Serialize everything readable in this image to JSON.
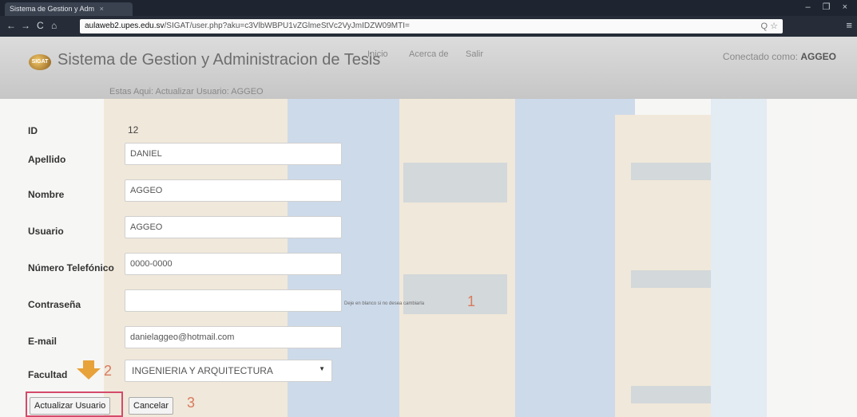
{
  "browser": {
    "tab_title": "Sistema de Gestion y Adm",
    "tab_close": "×",
    "url_host": "aulaweb2.upes.edu.sv",
    "url_path": "/SIGAT/user.php?aku=c3VlbWBPU1vZGlmeStVc2VyJmIDZW09MTI=",
    "back": "←",
    "forward": "→",
    "reload": "C",
    "home": "⌂",
    "omni_icons": "Q ☆",
    "menu": "≡",
    "window_controls": "– ❐ ×"
  },
  "header": {
    "logo_text": "SIGAT",
    "app_title": "Sistema de Gestion y Administracion de Tesis",
    "nav": [
      "Inicio",
      "Acerca de",
      "Salir"
    ],
    "connected_label": "Conectado como:",
    "connected_user": "AGGEO",
    "breadcrumb": "Estas Aqui: Actualizar Usuario: AGGEO"
  },
  "form": {
    "id_label": "ID",
    "id_value": "12",
    "apellido_label": "Apellido",
    "apellido_value": "DANIEL",
    "nombre_label": "Nombre",
    "nombre_value": "AGGEO",
    "usuario_label": "Usuario",
    "usuario_value": "AGGEO",
    "telefono_label": "Número Telefónico",
    "telefono_value": "0000-0000",
    "password_label": "Contraseña",
    "password_value": "",
    "password_hint": "Deje en blanco si no desea cambiarla",
    "email_label": "E-mail",
    "email_value": "danielaggeo@hotmail.com",
    "facultad_label": "Facultad",
    "facultad_value": "INGENIERIA Y ARQUITECTURA",
    "facultad_caret": "▼",
    "update_button": "Actualizar Usuario",
    "cancel_button": "Cancelar"
  },
  "annotations": {
    "one": "1",
    "two": "2",
    "three": "3"
  },
  "colors": {
    "highlight_box": "#d44a6a",
    "arrow": "#e8a23a",
    "annotation_text": "#d97a5e"
  }
}
